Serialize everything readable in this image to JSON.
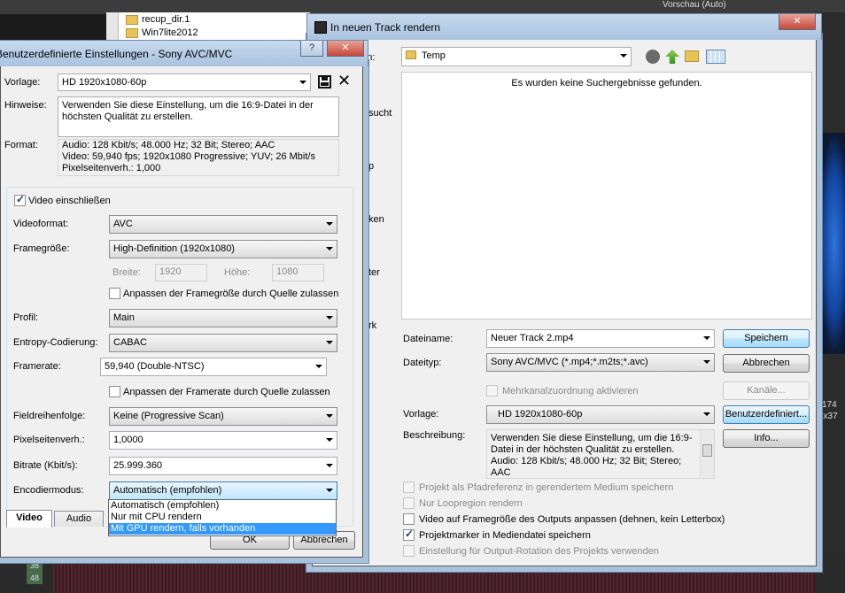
{
  "background": {
    "explorer_items": [
      "recup_dir.1",
      "Win7lite2012"
    ],
    "preview_label": "Vorschau (Auto)",
    "side_labels": [
      "sucht",
      "p",
      "ken",
      "ter",
      "rk"
    ],
    "timecode_a": "38",
    "timecode_b": "48",
    "right_labels": [
      "174",
      "6x37"
    ]
  },
  "render_dialog": {
    "title": "In neuen Track rendern",
    "save_in_label": "rn in:",
    "folder": "Temp",
    "empty_message": "Es wurden keine Suchergebnisse gefunden.",
    "filename_label": "Dateiname:",
    "filename_value": "Neuer Track 2.mp4",
    "filetype_label": "Dateityp:",
    "filetype_value": "Sony AVC/MVC (*.mp4;*.m2ts;*.avc)",
    "multichannel_label": "Mehrkanalzuordnung aktivieren",
    "template_label": "Vorlage:",
    "template_value": "HD 1920x1080-60p",
    "description_label": "Beschreibung:",
    "description_value": "Verwenden Sie diese Einstellung, um die 16:9-Datei in der höchsten Qualität zu erstellen. Audio: 128 Kbit/s; 48.000 Hz; 32 Bit; Stereo; AAC",
    "buttons": {
      "save": "Speichern",
      "cancel": "Abbrechen",
      "channels": "Kanäle...",
      "custom": "Benutzerdefiniert...",
      "info": "Info..."
    },
    "options": [
      {
        "label": "Projekt als Pfadreferenz in gerendertem Medium speichern",
        "checked": false,
        "enabled": false
      },
      {
        "label": "Nur Loopregion rendern",
        "checked": false,
        "enabled": false
      },
      {
        "label": "Video auf Framegröße des Outputs anpassen (dehnen, kein Letterbox)",
        "checked": false,
        "enabled": true
      },
      {
        "label": "Projektmarker in Mediendatei speichern",
        "checked": true,
        "enabled": true
      },
      {
        "label": "Einstellung für Output-Rotation des Projekts verwenden",
        "checked": false,
        "enabled": false
      }
    ]
  },
  "custom_dialog": {
    "title": "Benutzerdefinierte Einstellungen - Sony AVC/MVC",
    "template_label": "Vorlage:",
    "template_value": "HD 1920x1080-60p",
    "notes_label": "Hinweise:",
    "notes_value": "Verwenden Sie diese Einstellung, um die 16:9-Datei in der höchsten Qualität zu erstellen.",
    "format_label": "Format:",
    "format_lines": [
      "Audio: 128 Kbit/s; 48.000 Hz; 32 Bit; Stereo; AAC",
      "Video: 59,940 fps; 1920x1080 Progressive; YUV; 26 Mbit/s",
      "Pixelseitenverh.: 1,000"
    ],
    "include_video_label": "Video einschließen",
    "videoformat_label": "Videoformat:",
    "videoformat_value": "AVC",
    "framesize_label": "Framegröße:",
    "framesize_value": "High-Definition (1920x1080)",
    "width_label": "Breite:",
    "width_value": "1920",
    "height_label": "Höhe:",
    "height_value": "1080",
    "fit_framesize_label": "Anpassen der Framegröße durch Quelle zulassen",
    "profile_label": "Profil:",
    "profile_value": "Main",
    "entropy_label": "Entropy-Codierung:",
    "entropy_value": "CABAC",
    "framerate_label": "Framerate:",
    "framerate_value": "59,940 (Double-NTSC)",
    "fit_framerate_label": "Anpassen der Framerate durch Quelle zulassen",
    "fieldorder_label": "Fieldreihenfolge:",
    "fieldorder_value": "Keine (Progressive Scan)",
    "pixelaspect_label": "Pixelseitenverh.:",
    "pixelaspect_value": "1,0000",
    "bitrate_label": "Bitrate (Kbit/s):",
    "bitrate_value": "25.999.360",
    "encoder_label": "Encodiermodus:",
    "encoder_value": "Automatisch (empfohlen)",
    "encoder_options": [
      "Automatisch (empfohlen)",
      "Nur mit CPU rendern",
      "Mit GPU rendern, falls vorhanden"
    ],
    "encoder_selected_index": 2,
    "tabs": [
      "Video",
      "Audio"
    ],
    "ok_label": "OK",
    "cancel_label": "Abbrechen"
  },
  "colors": {
    "selection": "#3399ff",
    "titlebar": "#aac3df",
    "dialog_bg": "#f0f0f0"
  }
}
